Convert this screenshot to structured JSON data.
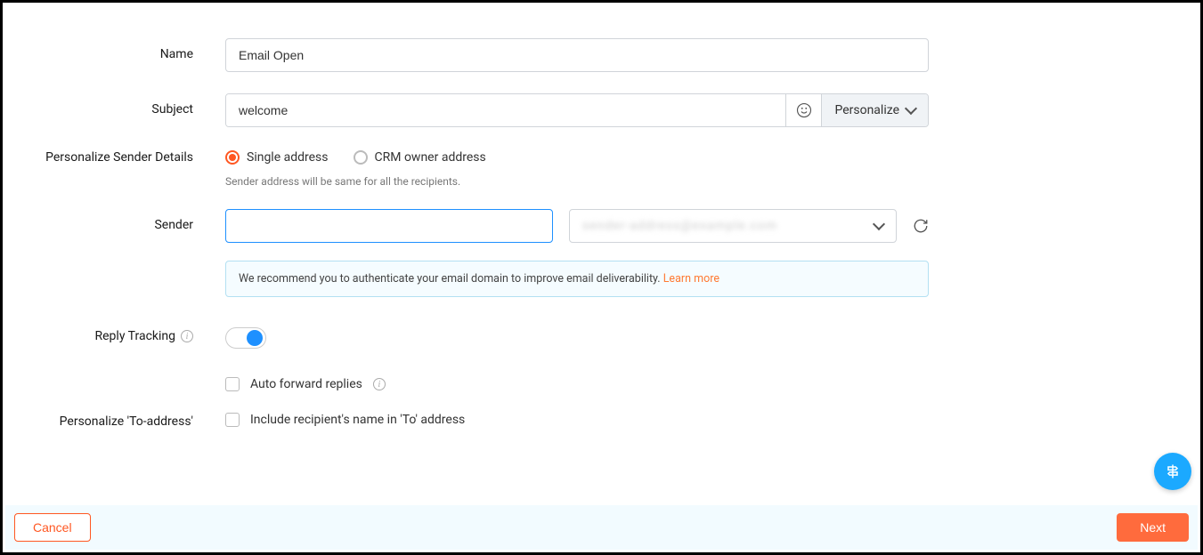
{
  "labels": {
    "name": "Name",
    "subject": "Subject",
    "personalize_sender": "Personalize Sender Details",
    "sender": "Sender",
    "reply_tracking": "Reply Tracking",
    "personalize_to": "Personalize 'To-address'"
  },
  "fields": {
    "name_value": "Email Open",
    "subject_value": "welcome",
    "personalize_button": "Personalize",
    "radio_single": "Single address",
    "radio_crm": "CRM owner address",
    "sender_helper": "Sender address will be same for all the recipients.",
    "sender_input_value": "",
    "sender_select_value": "",
    "auth_notice": "We recommend you to authenticate your email domain to improve email deliverability. ",
    "learn_more": "Learn more",
    "auto_forward": "Auto forward replies",
    "include_recipient": "Include recipient's name in 'To' address"
  },
  "footer": {
    "cancel": "Cancel",
    "next": "Next"
  }
}
